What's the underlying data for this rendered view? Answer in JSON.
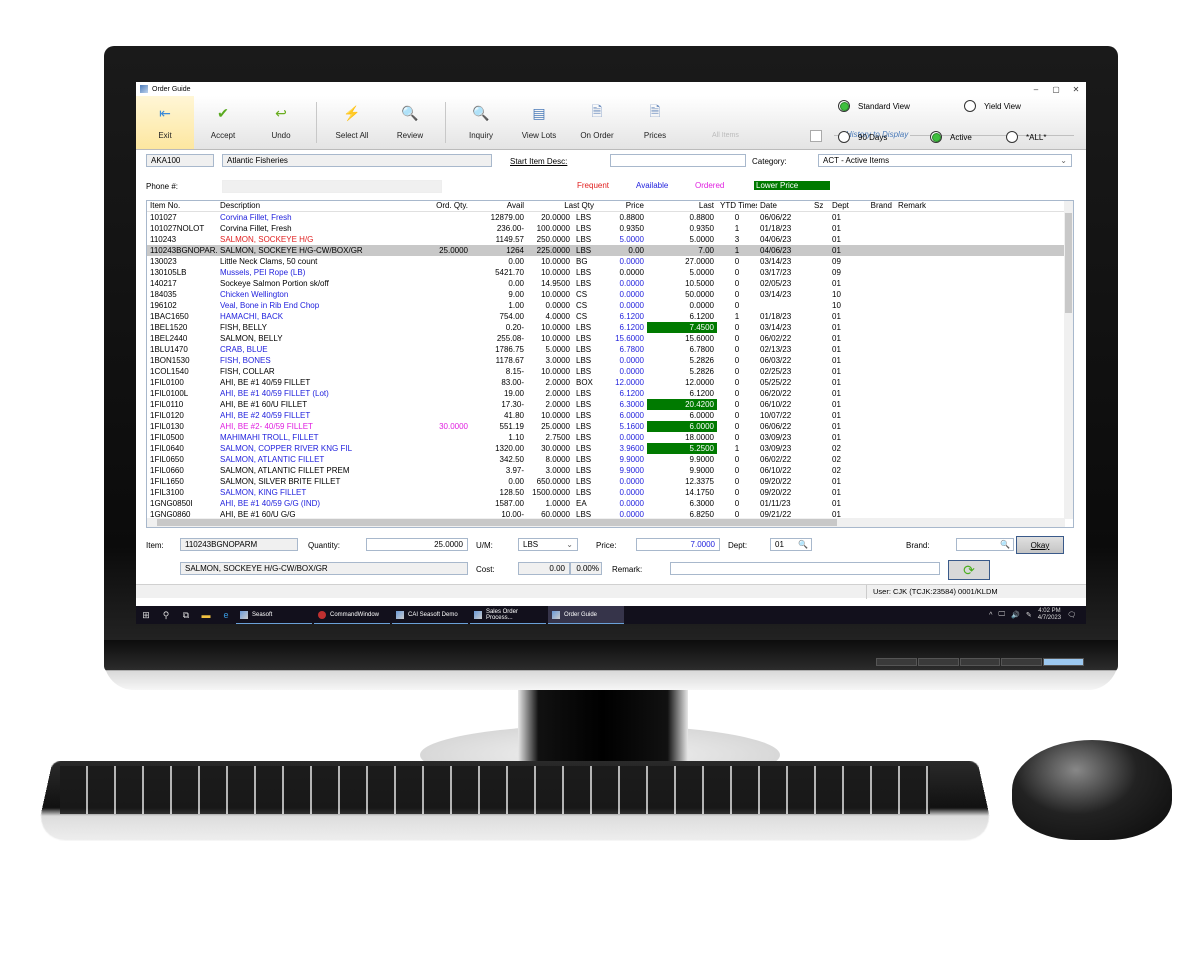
{
  "window": {
    "title": "Order Guide",
    "controls": [
      "–",
      "▢",
      "✕"
    ]
  },
  "ribbon": {
    "buttons": [
      {
        "label": "Exit",
        "icon": "exit-icon",
        "glyph": "⇤",
        "color": "#3a8ad8"
      },
      {
        "label": "Accept",
        "icon": "check-circle-icon",
        "glyph": "✔",
        "color": "#5aaa20"
      },
      {
        "label": "Undo",
        "icon": "undo-icon",
        "glyph": "↩",
        "color": "#6aae20"
      },
      {
        "label": "Select All",
        "icon": "lightning-icon",
        "glyph": "⚡",
        "color": "#f0b020"
      },
      {
        "label": "Review",
        "icon": "review-magnifier-icon",
        "glyph": "🔍",
        "color": "#7090c0"
      },
      {
        "label": "Inquiry",
        "icon": "magnifier-icon",
        "glyph": "🔍",
        "color": "#e0a020"
      },
      {
        "label": "View Lots",
        "icon": "view-lots-icon",
        "glyph": "▤",
        "color": "#4a7ab8"
      },
      {
        "label": "On Order",
        "icon": "on-order-icon",
        "glyph": "🗎",
        "color": "#7090c0"
      },
      {
        "label": "Prices",
        "icon": "prices-icon",
        "glyph": "🗎",
        "color": "#7090c0"
      }
    ],
    "all_items_label": "All Items",
    "view_options": [
      {
        "label": "Standard View",
        "selected": true
      },
      {
        "label": "Yield View",
        "selected": false
      }
    ],
    "history_label": "History to Display",
    "history_options": [
      {
        "label": "90 Days",
        "selected": false
      },
      {
        "label": "Active",
        "selected": true
      },
      {
        "label": "*ALL*",
        "selected": false
      }
    ]
  },
  "header": {
    "customer_code": "AKA100",
    "customer_name": "Atlantic Fisheries",
    "start_item_desc_label": "Start Item Desc:",
    "start_item_desc_value": "",
    "category_label": "Category:",
    "category_value": "ACT - Active Items",
    "phone_label": "Phone #:",
    "phone_value": ""
  },
  "legend": {
    "frequent": "Frequent",
    "available": "Available",
    "ordered": "Ordered",
    "lower_price": "Lower Price"
  },
  "colors": {
    "frequent": "#e02020",
    "available": "#2222dd",
    "ordered": "#e020e0",
    "lower_price": "#007a00"
  },
  "grid": {
    "columns": [
      "Item No.",
      "Description",
      "Ord. Qty.",
      "Avail",
      "Last Qty",
      "",
      "Price",
      "Last",
      "YTD Times",
      "Date",
      "Sz",
      "Dept",
      "Brand",
      "Remark"
    ],
    "rows": [
      {
        "item": "101027",
        "desc": "Corvina Fillet, Fresh",
        "dc": "blue",
        "ord": "",
        "avail": "12879.00",
        "lq": "20.0000",
        "um": "LBS",
        "price": "0.8800",
        "pc": "",
        "last": "0.8800",
        "lg": false,
        "ytd": "0",
        "date": "06/06/22",
        "sz": "",
        "dept": "01"
      },
      {
        "item": "101027NOLOT",
        "desc": "Corvina Fillet, Fresh",
        "dc": "",
        "ord": "",
        "avail": "236.00-",
        "lq": "100.0000",
        "um": "LBS",
        "price": "0.9350",
        "pc": "",
        "last": "0.9350",
        "lg": false,
        "ytd": "1",
        "date": "01/18/23",
        "sz": "",
        "dept": "01"
      },
      {
        "item": "110243",
        "desc": "SALMON, SOCKEYE H/G",
        "dc": "red",
        "ord": "",
        "avail": "1149.57",
        "lq": "250.0000",
        "um": "LBS",
        "price": "5.0000",
        "pc": "blue",
        "last": "5.0000",
        "lg": false,
        "ytd": "3",
        "date": "04/06/23",
        "sz": "",
        "dept": "01"
      },
      {
        "item": "110243BGNOPAR...",
        "desc": "SALMON, SOCKEYE H/G-CW/BOX/GR",
        "dc": "",
        "ord": "25.0000",
        "avail": "1264",
        "lq": "225.0000",
        "um": "LBS",
        "price": "0.00",
        "pc": "",
        "last": "7.00",
        "lg": false,
        "ytd": "1",
        "date": "04/06/23",
        "sz": "",
        "dept": "01",
        "selected": true
      },
      {
        "item": "130023",
        "desc": "Little Neck Clams, 50 count",
        "dc": "",
        "ord": "",
        "avail": "0.00",
        "lq": "10.0000",
        "um": "BG",
        "price": "0.0000",
        "pc": "blue",
        "last": "27.0000",
        "lg": false,
        "ytd": "0",
        "date": "03/14/23",
        "sz": "",
        "dept": "09"
      },
      {
        "item": "130105LB",
        "desc": "Mussels, PEI Rope (LB)",
        "dc": "blue",
        "ord": "",
        "avail": "5421.70",
        "lq": "10.0000",
        "um": "LBS",
        "price": "0.0000",
        "pc": "",
        "last": "5.0000",
        "lg": false,
        "ytd": "0",
        "date": "03/17/23",
        "sz": "",
        "dept": "09"
      },
      {
        "item": "140217",
        "desc": "Sockeye Salmon Portion sk/off",
        "dc": "",
        "ord": "",
        "avail": "0.00",
        "lq": "14.9500",
        "um": "LBS",
        "price": "0.0000",
        "pc": "blue",
        "last": "10.5000",
        "lg": false,
        "ytd": "0",
        "date": "02/05/23",
        "sz": "",
        "dept": "01"
      },
      {
        "item": "184035",
        "desc": "Chicken Wellington",
        "dc": "blue",
        "ord": "",
        "avail": "9.00",
        "lq": "10.0000",
        "um": "CS",
        "price": "0.0000",
        "pc": "blue",
        "last": "50.0000",
        "lg": false,
        "ytd": "0",
        "date": "03/14/23",
        "sz": "",
        "dept": "10"
      },
      {
        "item": "196102",
        "desc": "Veal, Bone in Rib End Chop",
        "dc": "blue",
        "ord": "",
        "avail": "1.00",
        "lq": "0.0000",
        "um": "CS",
        "price": "0.0000",
        "pc": "blue",
        "last": "0.0000",
        "lg": false,
        "ytd": "0",
        "date": "",
        "sz": "",
        "dept": "10"
      },
      {
        "item": "1BAC1650",
        "desc": "HAMACHI, BACK",
        "dc": "blue",
        "ord": "",
        "avail": "754.00",
        "lq": "4.0000",
        "um": "CS",
        "price": "6.1200",
        "pc": "blue",
        "last": "6.1200",
        "lg": false,
        "ytd": "1",
        "date": "01/18/23",
        "sz": "",
        "dept": "01"
      },
      {
        "item": "1BEL1520",
        "desc": "FISH, BELLY",
        "dc": "",
        "ord": "",
        "avail": "0.20-",
        "lq": "10.0000",
        "um": "LBS",
        "price": "6.1200",
        "pc": "blue",
        "last": "7.4500",
        "lg": true,
        "ytd": "0",
        "date": "03/14/23",
        "sz": "",
        "dept": "01"
      },
      {
        "item": "1BEL2440",
        "desc": "SALMON, BELLY",
        "dc": "",
        "ord": "",
        "avail": "255.08-",
        "lq": "10.0000",
        "um": "LBS",
        "price": "15.6000",
        "pc": "blue",
        "last": "15.6000",
        "lg": false,
        "ytd": "0",
        "date": "06/02/22",
        "sz": "",
        "dept": "01"
      },
      {
        "item": "1BLU1470",
        "desc": "CRAB, BLUE",
        "dc": "blue",
        "ord": "",
        "avail": "1786.75",
        "lq": "5.0000",
        "um": "LBS",
        "price": "6.7800",
        "pc": "blue",
        "last": "6.7800",
        "lg": false,
        "ytd": "0",
        "date": "02/13/23",
        "sz": "",
        "dept": "01"
      },
      {
        "item": "1BON1530",
        "desc": "FISH, BONES",
        "dc": "blue",
        "ord": "",
        "avail": "1178.67",
        "lq": "3.0000",
        "um": "LBS",
        "price": "0.0000",
        "pc": "blue",
        "last": "5.2826",
        "lg": false,
        "ytd": "0",
        "date": "06/03/22",
        "sz": "",
        "dept": "01"
      },
      {
        "item": "1COL1540",
        "desc": "FISH, COLLAR",
        "dc": "",
        "ord": "",
        "avail": "8.15-",
        "lq": "10.0000",
        "um": "LBS",
        "price": "0.0000",
        "pc": "blue",
        "last": "5.2826",
        "lg": false,
        "ytd": "0",
        "date": "02/25/23",
        "sz": "",
        "dept": "01"
      },
      {
        "item": "1FIL0100",
        "desc": "AHI, BE #1 40/59 FILLET",
        "dc": "",
        "ord": "",
        "avail": "83.00-",
        "lq": "2.0000",
        "um": "BOX",
        "price": "12.0000",
        "pc": "blue",
        "last": "12.0000",
        "lg": false,
        "ytd": "0",
        "date": "05/25/22",
        "sz": "",
        "dept": "01"
      },
      {
        "item": "1FIL0100L",
        "desc": "AHI, BE #1 40/59 FILLET (Lot)",
        "dc": "blue",
        "ord": "",
        "avail": "19.00",
        "lq": "2.0000",
        "um": "LBS",
        "price": "6.1200",
        "pc": "blue",
        "last": "6.1200",
        "lg": false,
        "ytd": "0",
        "date": "06/20/22",
        "sz": "",
        "dept": "01"
      },
      {
        "item": "1FIL0110",
        "desc": "AHI, BE #1 60/U FILLET",
        "dc": "",
        "ord": "",
        "avail": "17.30-",
        "lq": "2.0000",
        "um": "LBS",
        "price": "6.3000",
        "pc": "blue",
        "last": "20.4200",
        "lg": true,
        "ytd": "0",
        "date": "06/10/22",
        "sz": "",
        "dept": "01"
      },
      {
        "item": "1FIL0120",
        "desc": "AHI, BE #2 40/59 FILLET",
        "dc": "blue",
        "ord": "",
        "avail": "41.80",
        "lq": "10.0000",
        "um": "LBS",
        "price": "6.0000",
        "pc": "blue",
        "last": "6.0000",
        "lg": false,
        "ytd": "0",
        "date": "10/07/22",
        "sz": "",
        "dept": "01"
      },
      {
        "item": "1FIL0130",
        "desc": "AHI, BE #2- 40/59 FILLET",
        "dc": "mag",
        "ord": "30.0000",
        "oc": "mag",
        "avail": "551.19",
        "lq": "25.0000",
        "um": "LBS",
        "price": "5.1600",
        "pc": "blue",
        "last": "6.0000",
        "lg": true,
        "ytd": "0",
        "date": "06/06/22",
        "sz": "",
        "dept": "01"
      },
      {
        "item": "1FIL0500",
        "desc": "MAHIMAHI TROLL, FILLET",
        "dc": "blue",
        "ord": "",
        "avail": "1.10",
        "lq": "2.7500",
        "um": "LBS",
        "price": "0.0000",
        "pc": "blue",
        "last": "18.0000",
        "lg": false,
        "ytd": "0",
        "date": "03/09/23",
        "sz": "",
        "dept": "01"
      },
      {
        "item": "1FIL0640",
        "desc": "SALMON, COPPER RIVER KNG  FIL",
        "dc": "blue",
        "ord": "",
        "avail": "1320.00",
        "lq": "30.0000",
        "um": "LBS",
        "price": "3.9600",
        "pc": "blue",
        "last": "5.2500",
        "lg": true,
        "ytd": "1",
        "date": "03/09/23",
        "sz": "",
        "dept": "02"
      },
      {
        "item": "1FIL0650",
        "desc": "SALMON, ATLANTIC FILLET",
        "dc": "blue",
        "ord": "",
        "avail": "342.50",
        "lq": "8.0000",
        "um": "LBS",
        "price": "9.9000",
        "pc": "blue",
        "last": "9.9000",
        "lg": false,
        "ytd": "0",
        "date": "06/02/22",
        "sz": "",
        "dept": "02"
      },
      {
        "item": "1FIL0660",
        "desc": "SALMON, ATLANTIC FILLET PREM",
        "dc": "",
        "ord": "",
        "avail": "3.97-",
        "lq": "3.0000",
        "um": "LBS",
        "price": "9.9000",
        "pc": "blue",
        "last": "9.9000",
        "lg": false,
        "ytd": "0",
        "date": "06/10/22",
        "sz": "",
        "dept": "02"
      },
      {
        "item": "1FIL1650",
        "desc": "SALMON, SILVER BRITE FILLET",
        "dc": "",
        "ord": "",
        "avail": "0.00",
        "lq": "650.0000",
        "um": "LBS",
        "price": "0.0000",
        "pc": "blue",
        "last": "12.3375",
        "lg": false,
        "ytd": "0",
        "date": "09/20/22",
        "sz": "",
        "dept": "01"
      },
      {
        "item": "1FIL3100",
        "desc": "SALMON, KING  FILLET",
        "dc": "blue",
        "ord": "",
        "avail": "128.50",
        "lq": "1500.0000",
        "um": "LBS",
        "price": "0.0000",
        "pc": "blue",
        "last": "14.1750",
        "lg": false,
        "ytd": "0",
        "date": "09/20/22",
        "sz": "",
        "dept": "01"
      },
      {
        "item": "1GNG0850I",
        "desc": "AHI, BE #1 40/59 G/G (IND)",
        "dc": "blue",
        "ord": "",
        "avail": "1587.00",
        "lq": "1.0000",
        "um": "EA",
        "price": "0.0000",
        "pc": "blue",
        "last": "6.3000",
        "lg": false,
        "ytd": "0",
        "date": "01/11/23",
        "sz": "",
        "dept": "01"
      },
      {
        "item": "1GNG0860",
        "desc": "AHI, BE #1 60/U G/G",
        "dc": "",
        "ord": "",
        "avail": "10.00-",
        "lq": "60.0000",
        "um": "LBS",
        "price": "0.0000",
        "pc": "blue",
        "last": "6.8250",
        "lg": false,
        "ytd": "0",
        "date": "09/21/22",
        "sz": "",
        "dept": "01"
      }
    ]
  },
  "entry": {
    "item_label": "Item:",
    "item_value": "110243BGNOPARM",
    "quantity_label": "Quantity:",
    "quantity_value": "25.0000",
    "um_label": "U/M:",
    "um_value": "LBS",
    "price_label": "Price:",
    "price_value": "7.0000",
    "dept_label": "Dept:",
    "dept_value": "01",
    "brand_label": "Brand:",
    "brand_value": "",
    "okay_label": "Okay",
    "description_value": "SALMON, SOCKEYE H/G-CW/BOX/GR",
    "cost_label": "Cost:",
    "cost_value": "0.00",
    "cost_pct": "0.00%",
    "remark_label": "Remark:",
    "remark_value": ""
  },
  "status": {
    "user": "User: CJK  (TCJK:23584) 0001/KLDM"
  },
  "taskbar": {
    "apps": [
      {
        "label": "Seasoft",
        "active": false
      },
      {
        "label": "CommandWindow",
        "active": false
      },
      {
        "label": "CAI Seasoft Demo",
        "active": false
      },
      {
        "label": "Sales Order Process...",
        "active": false
      },
      {
        "label": "Order Guide",
        "active": true
      }
    ],
    "time": "4:02 PM",
    "date": "4/7/2023"
  }
}
